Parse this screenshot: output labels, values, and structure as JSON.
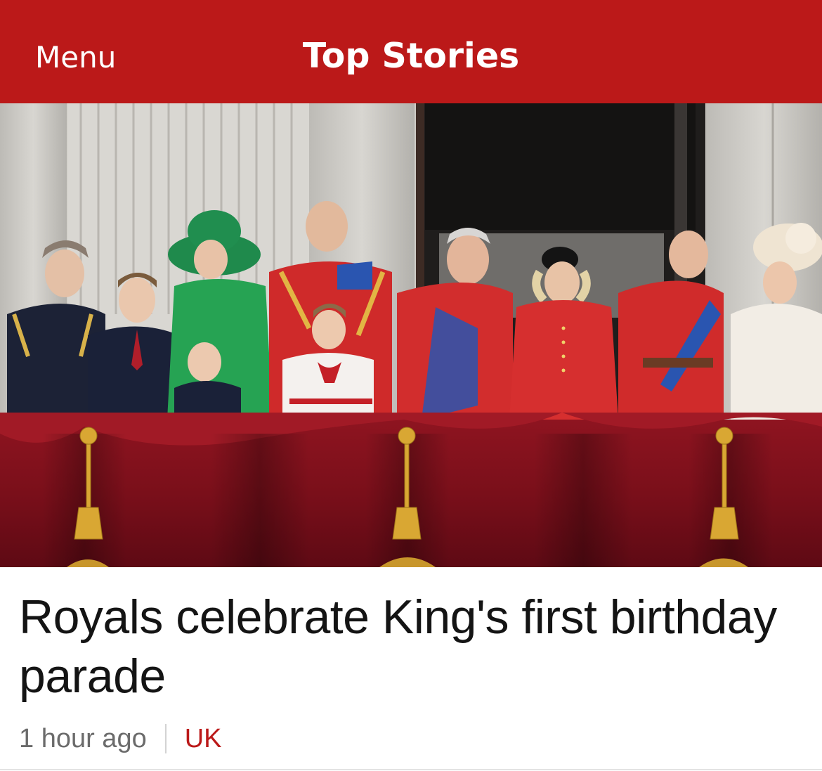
{
  "header": {
    "menu_label": "Menu",
    "title": "Top Stories"
  },
  "story": {
    "headline": "Royals celebrate King's first birthday parade",
    "time": "1 hour ago",
    "topic": "UK"
  },
  "colors": {
    "brand_red": "#bb1919",
    "headline_text": "#141414",
    "meta_text": "#6b6b6b"
  }
}
